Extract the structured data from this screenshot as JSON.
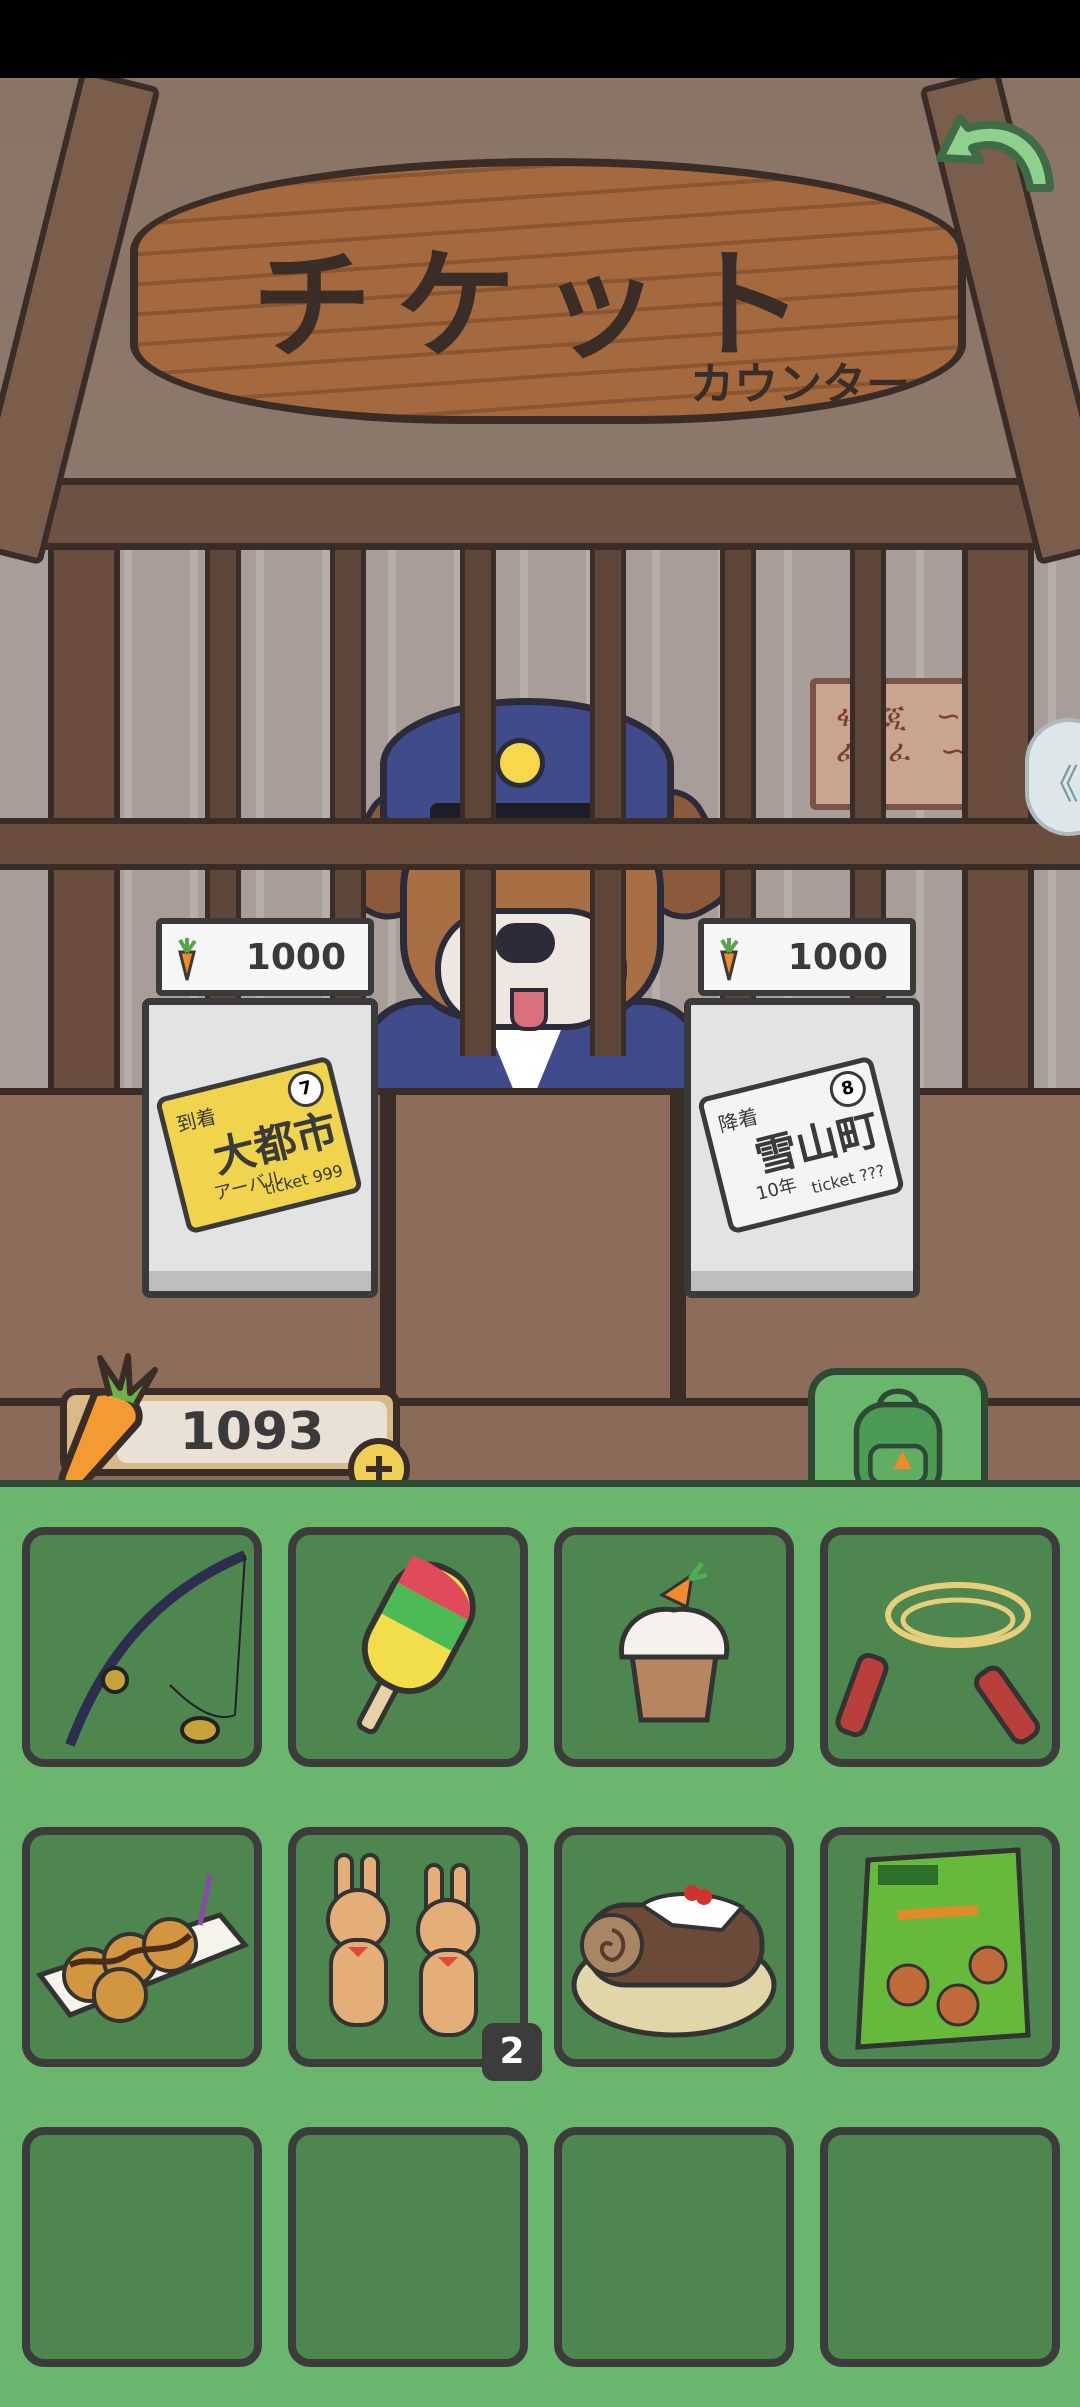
{
  "sign": {
    "title": "チケット",
    "subtitle": "カウンター"
  },
  "tickets": [
    {
      "price": "1000",
      "number": "7",
      "line_a": "到着",
      "destination": "大都市",
      "line_c": "アーバル",
      "line_d": "ticket 999"
    },
    {
      "price": "1000",
      "number": "8",
      "line_a": "降着",
      "destination": "雪山町",
      "line_c": "10年",
      "line_d": "ticket ???"
    }
  ],
  "wallet": {
    "carrots": "1093"
  },
  "inventory": {
    "items": [
      {
        "icon": "fishing-rod-icon",
        "quantity": null
      },
      {
        "icon": "popsicle-icon",
        "quantity": null
      },
      {
        "icon": "cupcake-icon",
        "quantity": null
      },
      {
        "icon": "jump-rope-icon",
        "quantity": null
      },
      {
        "icon": "takoyaki-icon",
        "quantity": null
      },
      {
        "icon": "bunny-cookies-icon",
        "quantity": "2"
      },
      {
        "icon": "yule-log-cake-icon",
        "quantity": null
      },
      {
        "icon": "carrot-snack-bag-icon",
        "quantity": null
      },
      {
        "icon": "empty-slot",
        "quantity": null
      },
      {
        "icon": "empty-slot",
        "quantity": null
      },
      {
        "icon": "empty-slot",
        "quantity": null
      },
      {
        "icon": "empty-slot",
        "quantity": null
      }
    ]
  },
  "colors": {
    "grass": "#6ab66d",
    "slot": "#4d864f",
    "wood": "#a4693f",
    "coin_gold": "#efcf54"
  }
}
